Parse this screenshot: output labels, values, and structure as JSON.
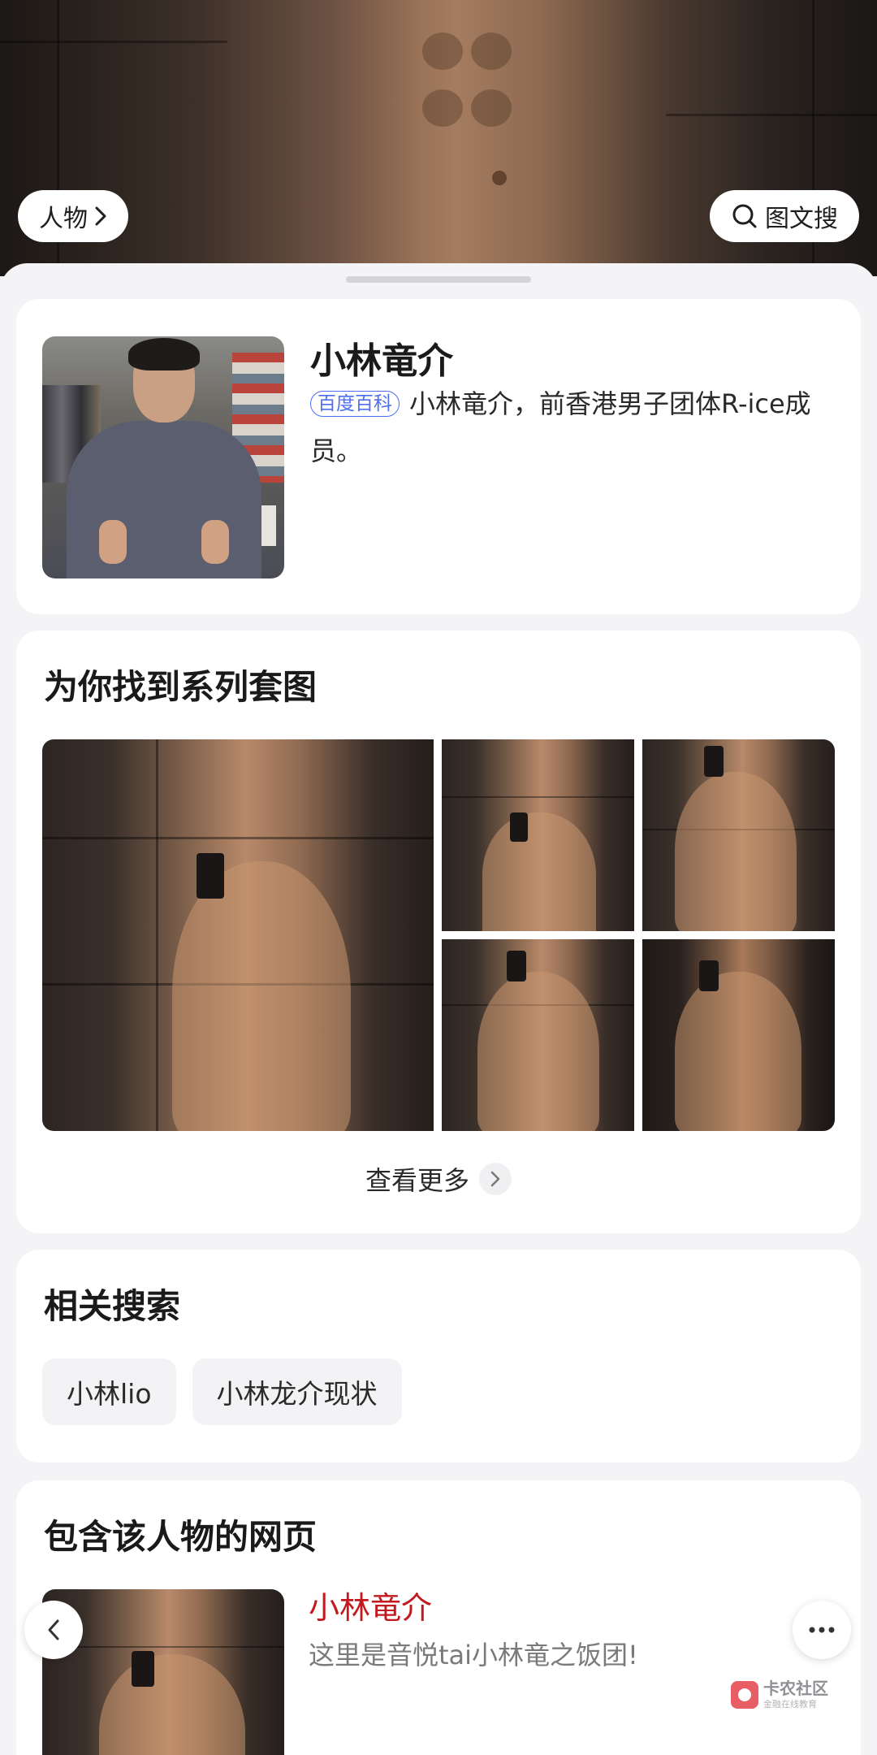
{
  "hero": {
    "category_pill": "人物",
    "search_pill": "图文搜"
  },
  "profile": {
    "name": "小林竜介",
    "source_badge": "百度百科",
    "description": "小林竜介，前香港男子团体R-ice成员。"
  },
  "gallery": {
    "title": "为你找到系列套图",
    "more_label": "查看更多"
  },
  "related": {
    "title": "相关搜索",
    "chips": [
      "小林lio",
      "小林龙介现状"
    ]
  },
  "web_pages": {
    "title": "包含该人物的网页",
    "items": [
      {
        "title": "小林竜介",
        "desc": "这里是音悦tai小林竜之饭团!"
      }
    ]
  },
  "watermark": {
    "main": "卡农社区",
    "sub": "金融在线教育"
  },
  "colors": {
    "accent_blue": "#4e6ef2",
    "link_red": "#c2191f",
    "sheet_bg": "#f4f4f6"
  },
  "icons": [
    "chevron-right-icon",
    "search-icon",
    "back-arrow-icon",
    "more-dots-icon"
  ]
}
